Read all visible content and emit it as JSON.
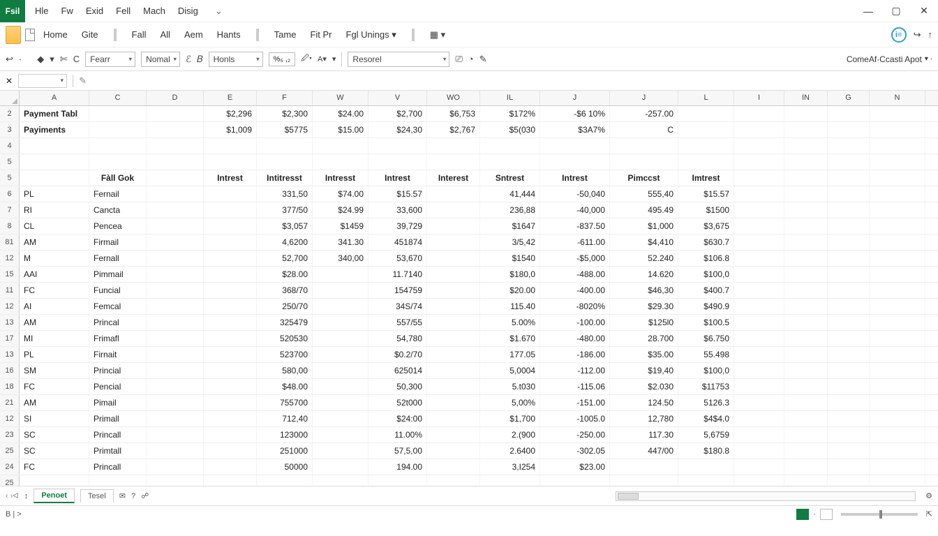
{
  "app_badge": "Fsil",
  "title_menu": [
    "Hle",
    "Fw",
    "Exid",
    "Fell",
    "Mach",
    "Disig"
  ],
  "ribbon_tabs": {
    "group1": [
      "Home",
      "Gite"
    ],
    "group2": [
      "Fall",
      "All",
      "Aem",
      "Hants"
    ],
    "group3": [
      "Tame",
      "Fit Pr",
      "Fgl Unings ▾"
    ]
  },
  "ribbon_right_label": "ComeAf·Ccasti Apot",
  "toolbar": {
    "font_name": "Fearr",
    "style": "Nomal",
    "name2": "Honls",
    "num_fmt": "%₅ ,₂",
    "cell_style": "Resorel"
  },
  "formula_bar": {
    "name_box": "",
    "value": ""
  },
  "columns": [
    "A",
    "C",
    "D",
    "E",
    "F",
    "W",
    "V",
    "WO",
    "IL",
    "J",
    "J",
    "L",
    "I",
    "IN",
    "G",
    "N"
  ],
  "rows": [
    {
      "n": "2",
      "A": "Payment Tabl",
      "E": "$2,296",
      "F": "$2,300",
      "W": "$24.00",
      "V": "$2,700",
      "WO": "$6,753",
      "IL": "$172%",
      "J1": "-$6 10%",
      "J2": "-257.00"
    },
    {
      "n": "3",
      "A": "Payiments",
      "E": "$1,009",
      "F": "$5775",
      "W": "$15.00",
      "V": "$24,30",
      "WO": "$2,767",
      "IL": "$5(030",
      "J1": "$3A7%",
      "J2": "C"
    },
    {
      "n": "4"
    },
    {
      "n": "5"
    },
    {
      "n": "5",
      "C": "Fàll Gok",
      "E": "Intrest",
      "F": "Intitresst",
      "W": "Intresst",
      "V": "Intrest",
      "WO": "Interest",
      "IL": "Sntrest",
      "J1": "Intrest",
      "J2": "Pimccst",
      "L": "Imtrest"
    },
    {
      "n": "6",
      "A": "PL",
      "C": "Fernail",
      "F": "331,50",
      "W": "$74.00",
      "V": "$15.57",
      "IL": "41,444",
      "J1": "-50,040",
      "J2": "555,40",
      "L": "$15.57"
    },
    {
      "n": "7",
      "A": "RI",
      "C": "Cancta",
      "F": "377/50",
      "W": "$24.99",
      "V": "33,600",
      "IL": "236,88",
      "J1": "-40,000",
      "J2": "495.49",
      "L": "$1500"
    },
    {
      "n": "8",
      "A": "CL",
      "C": "Pencea",
      "F": "$3,057",
      "W": "$1459",
      "V": "39,729",
      "IL": "$1647",
      "J1": "-837.50",
      "J2": "$1,000",
      "L": "$3,675"
    },
    {
      "n": "81",
      "A": "AM",
      "C": "Firmail",
      "F": "4,6200",
      "W": "341.30",
      "V": "451874",
      "IL": "3/5,42",
      "J1": "-611.00",
      "J2": "$4,410",
      "L": "$630.7"
    },
    {
      "n": "12",
      "A": "M",
      "C": "Fernall",
      "F": "52,700",
      "W": "340,00",
      "V": "53,670",
      "IL": "$1540",
      "J1": "-$5,000",
      "J2": "52.240",
      "L": "$106.8"
    },
    {
      "n": "15",
      "A": "AAI",
      "C": "Pimmail",
      "F": "$28.00",
      "V": "11.7140",
      "IL": "$180,0",
      "J1": "-488.00",
      "J2": "14.620",
      "L": "$100,0"
    },
    {
      "n": "11",
      "A": "FC",
      "C": "Funcial",
      "F": "368/70",
      "V": "154759",
      "IL": "$20.00",
      "J1": "-400.00",
      "J2": "$46,30",
      "L": "$400.7"
    },
    {
      "n": "12",
      "A": "AI",
      "C": "Femcal",
      "F": "250/70",
      "V": "34S/74",
      "IL": "115.40",
      "J1": "-8020%",
      "J2": "$29.30",
      "L": "$490.9"
    },
    {
      "n": "13",
      "A": "AM",
      "C": "Princal",
      "F": "325479",
      "V": "557/55",
      "IL": "5.00%",
      "J1": "-100.00",
      "J2": "$125l0",
      "L": "$100.5"
    },
    {
      "n": "17",
      "A": "MI",
      "C": "Frimafl",
      "F": "520530",
      "V": "54,780",
      "IL": "$1.670",
      "J1": "-480.00",
      "J2": "28.700",
      "L": "$6.750"
    },
    {
      "n": "13",
      "A": "PL",
      "C": "Firnait",
      "F": "523700",
      "V": "$0.2/70",
      "IL": "177.05",
      "J1": "-186.00",
      "J2": "$35.00",
      "L": "55.498"
    },
    {
      "n": "16",
      "A": "SM",
      "C": "Princial",
      "F": "580,00",
      "V": "625014",
      "IL": "5,0004",
      "J1": "-112.00",
      "J2": "$19,40",
      "L": "$100,0"
    },
    {
      "n": "18",
      "A": "FC",
      "C": "Pencial",
      "F": "$48.00",
      "V": "50,300",
      "IL": "5.t030",
      "J1": "-115.06",
      "J2": "$2.030",
      "L": "$11753"
    },
    {
      "n": "21",
      "A": "AM",
      "C": "Pimail",
      "F": "755700",
      "V": "52t000",
      "IL": "5,00%",
      "J1": "-151.00",
      "J2": "124.50",
      "L": "5126.3"
    },
    {
      "n": "12",
      "A": "SI",
      "C": "Primall",
      "F": "712,40",
      "V": "$24:00",
      "IL": "$1,700",
      "J1": "-1005.0",
      "J2": "12,780",
      "L": "$4$4.0"
    },
    {
      "n": "23",
      "A": "SC",
      "C": "Princall",
      "F": "123000",
      "V": "11.00%",
      "IL": "2.(900",
      "J1": "-250.00",
      "J2": "117.30",
      "L": "5,6759"
    },
    {
      "n": "25",
      "A": "SC",
      "C": "Primtall",
      "F": "251000",
      "V": "57,5,00",
      "IL": "2.6400",
      "J1": "-302.05",
      "J2": "447/00",
      "L": "$180.8"
    },
    {
      "n": "24",
      "A": "FC",
      "C": "Princall",
      "F": "50000",
      "V": "194.00",
      "IL": "3,I254",
      "J1": "$23.00"
    },
    {
      "n": "25"
    }
  ],
  "sheet_tabs": {
    "nav": "‹ ›ᐊ",
    "tabs": [
      "Penoet",
      "Tesel"
    ],
    "active": 0
  },
  "status": {
    "left": "B   |   >",
    "right_items": []
  }
}
